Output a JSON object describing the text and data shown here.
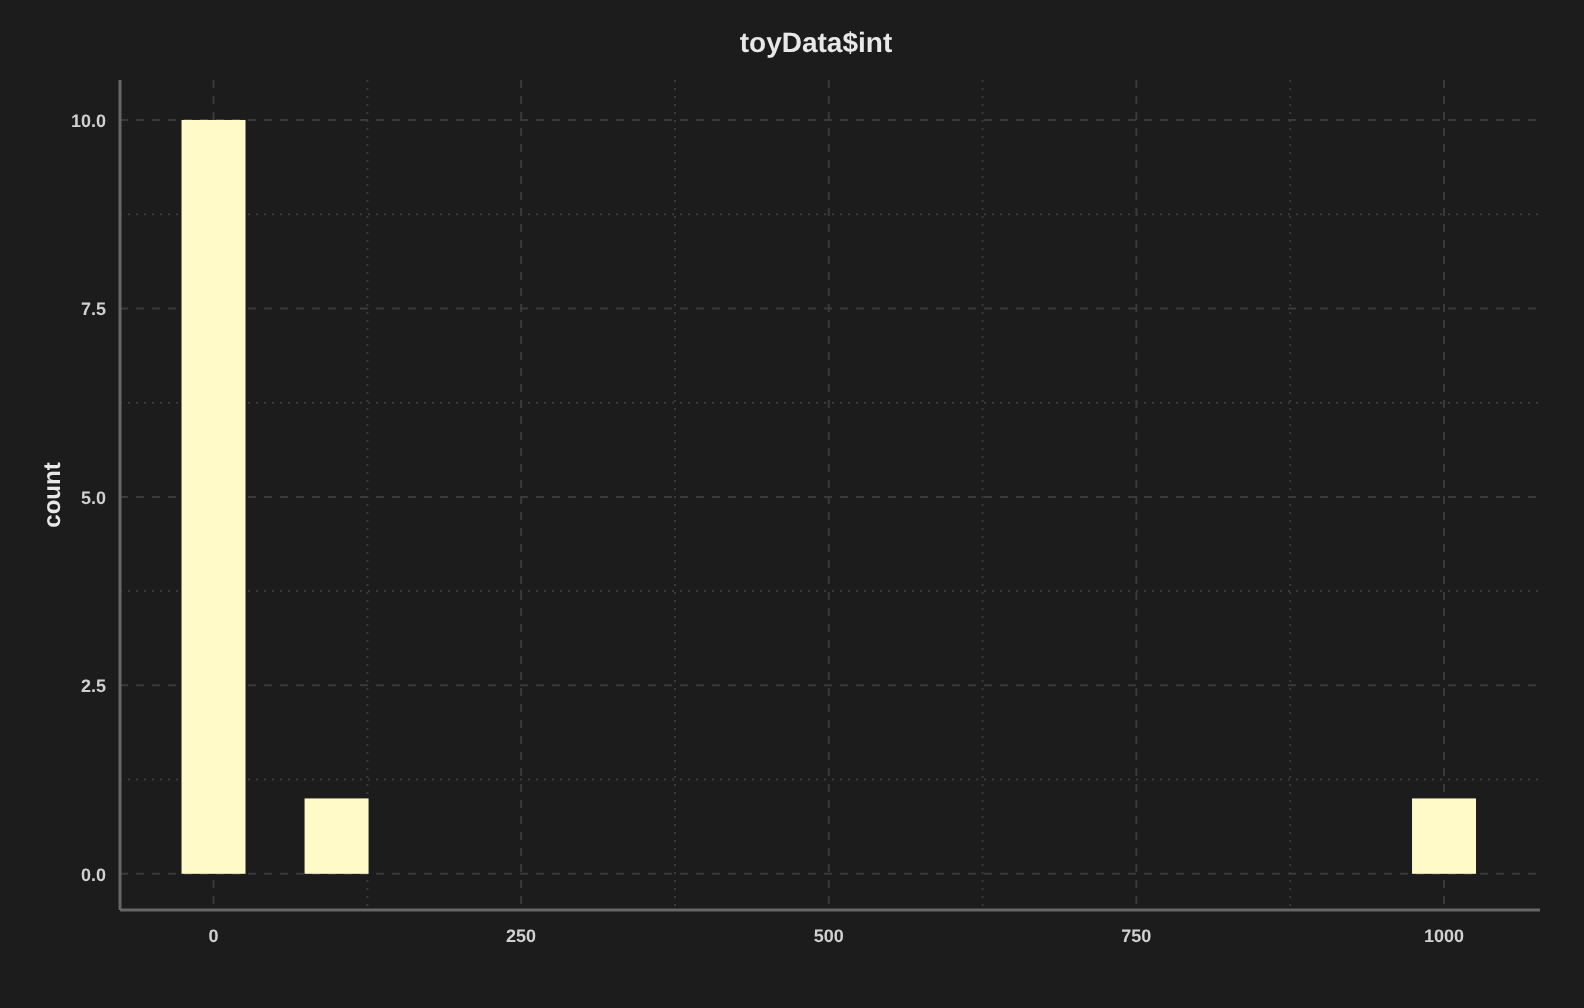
{
  "chart_data": {
    "type": "bar",
    "title": "toyData$int",
    "ylabel": "count",
    "x": [
      0,
      100,
      1000
    ],
    "series": [
      {
        "color": "#fffac8",
        "values": [
          10,
          1,
          1
        ]
      }
    ],
    "grid": true,
    "xlim": [
      -76,
      1078
    ],
    "ylim": [
      -0.48,
      10.53
    ],
    "xticks": [
      0,
      250,
      500,
      750,
      1000
    ],
    "yticks": [
      {
        "value": 0,
        "label": "0.0"
      },
      {
        "value": 2.5,
        "label": "2.5"
      },
      {
        "value": 5,
        "label": "5.0"
      },
      {
        "value": 7.5,
        "label": "7.5"
      },
      {
        "value": 10,
        "label": "10.0"
      }
    ]
  }
}
